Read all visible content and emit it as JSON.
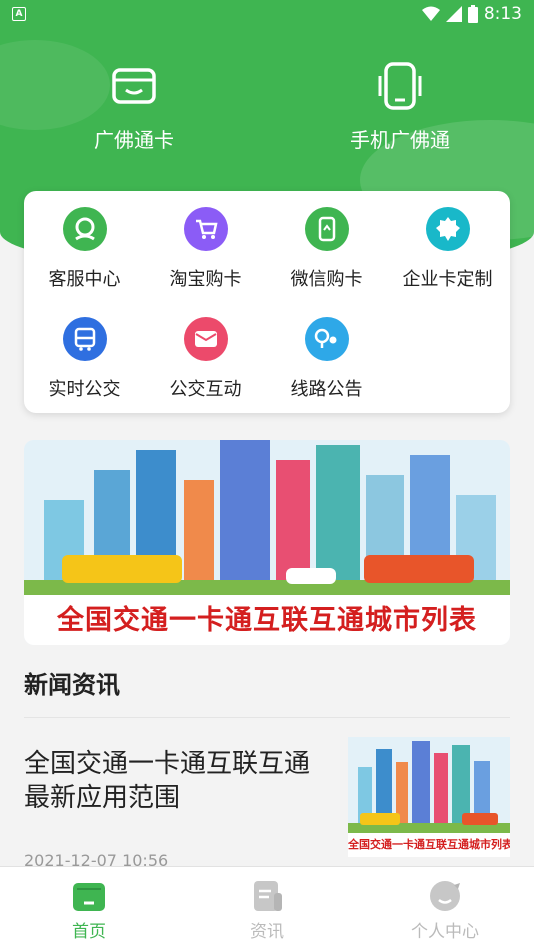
{
  "status": {
    "time": "8:13",
    "left_badge": "A"
  },
  "header": {
    "cards": [
      {
        "label": "广佛通卡",
        "icon": "card-icon"
      },
      {
        "label": "手机广佛通",
        "icon": "phone-icon"
      }
    ]
  },
  "services": [
    {
      "label": "客服中心",
      "icon": "customer-service-icon",
      "color": "#3fb551"
    },
    {
      "label": "淘宝购卡",
      "icon": "shopping-cart-icon",
      "color": "#8b5cf6"
    },
    {
      "label": "微信购卡",
      "icon": "wechat-phone-icon",
      "color": "#3fb551"
    },
    {
      "label": "企业卡定制",
      "icon": "enterprise-icon",
      "color": "#19b8c9"
    },
    {
      "label": "实时公交",
      "icon": "bus-icon",
      "color": "#2f6fe0"
    },
    {
      "label": "公交互动",
      "icon": "mail-icon",
      "color": "#ec4a6b"
    },
    {
      "label": "线路公告",
      "icon": "route-icon",
      "color": "#2ea8e8"
    }
  ],
  "banner": {
    "text": "全国交通一卡通互联互通城市列表"
  },
  "news": {
    "section_title": "新闻资讯",
    "items": [
      {
        "title": "全国交通一卡通互联互通最新应用范围",
        "date": "2021-12-07 10:56",
        "thumb_text": "全国交通一卡通互联互通城市列表"
      }
    ]
  },
  "tabbar": {
    "tabs": [
      {
        "label": "首页",
        "icon": "home-icon",
        "active": true
      },
      {
        "label": "资讯",
        "icon": "news-icon",
        "active": false
      },
      {
        "label": "个人中心",
        "icon": "profile-icon",
        "active": false
      }
    ]
  },
  "colors": {
    "primary": "#3fb551",
    "banner_red": "#d41f1f"
  }
}
